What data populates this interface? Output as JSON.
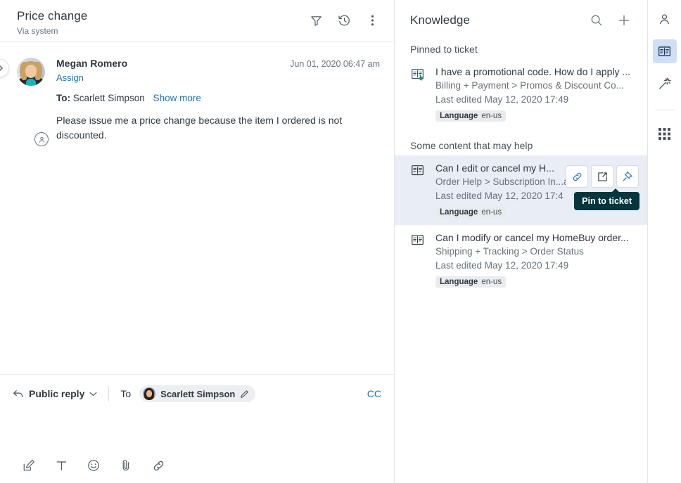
{
  "ticket": {
    "title": "Price change",
    "subtitle": "Via system",
    "header_actions": [
      {
        "name": "filter-icon",
        "label": "Filter"
      },
      {
        "name": "history-icon",
        "label": "Events history"
      },
      {
        "name": "more-options-icon",
        "label": "More options"
      }
    ],
    "message": {
      "author": "Megan Romero",
      "timestamp": "Jun 01, 2020 06:47 am",
      "assign_label": "Assign",
      "to_label": "To:",
      "to_value": "Scarlett Simpson",
      "show_more_label": "Show more",
      "text": "Please issue me a price change because the item I ordered is not discounted."
    }
  },
  "composer": {
    "reply_type": "Public reply",
    "to_label": "To",
    "recipient": "Scarlett Simpson",
    "cc_label": "CC",
    "tools": [
      {
        "name": "rich-text-icon",
        "label": "Rich text editor"
      },
      {
        "name": "text-format-icon",
        "label": "Text formatting"
      },
      {
        "name": "emoji-icon",
        "label": "Insert emoji"
      },
      {
        "name": "attachment-icon",
        "label": "Attach file"
      },
      {
        "name": "link-icon",
        "label": "Insert link"
      }
    ]
  },
  "knowledge": {
    "title": "Knowledge",
    "search_label": "Search",
    "add_label": "Add",
    "sections": [
      {
        "heading": "Pinned to ticket",
        "items": [
          {
            "title": "I have a promotional code. How do I apply ...",
            "path": "Billing + Payment > Promos & Discount Co...",
            "edited": "Last edited May 12, 2020 17:49",
            "badge_key": "Language",
            "badge_value": "en-us",
            "pinned": true,
            "hovered": false
          }
        ]
      },
      {
        "heading": "Some content that may help",
        "items": [
          {
            "title": "Can I edit or cancel my H...",
            "path": "Order Help > Subscription In...a",
            "edited": "Last edited May 12, 2020 17:4",
            "badge_key": "Language",
            "badge_value": "en-us",
            "pinned": false,
            "hovered": true
          },
          {
            "title": "Can I modify or cancel my HomeBuy order...",
            "path": "Shipping + Tracking > Order Status",
            "edited": "Last edited May 12, 2020 17:49",
            "badge_key": "Language",
            "badge_value": "en-us",
            "pinned": false,
            "hovered": false
          }
        ]
      }
    ],
    "hover_actions": [
      {
        "name": "copy-link-icon",
        "label": "Copy link"
      },
      {
        "name": "open-external-icon",
        "label": "Open in new tab"
      },
      {
        "name": "pin-icon",
        "label": "Pin to ticket"
      }
    ],
    "tooltip": "Pin to ticket"
  },
  "rail": {
    "items": [
      {
        "name": "user-icon",
        "label": "Customer context",
        "active": false
      },
      {
        "name": "knowledge-book-icon",
        "label": "Knowledge",
        "active": true
      },
      {
        "name": "magic-wand-icon",
        "label": "Suggestions",
        "active": false
      },
      {
        "name": "apps-grid-icon",
        "label": "Apps",
        "active": false
      }
    ]
  },
  "colors": {
    "accent_blue": "#1f73b7",
    "hover_row": "#e8edf6",
    "rail_active": "#cfdff5",
    "tooltip_bg": "#03363d",
    "text_primary": "#2f3941",
    "text_secondary": "#68737d",
    "pin_green": "#227d6c"
  }
}
